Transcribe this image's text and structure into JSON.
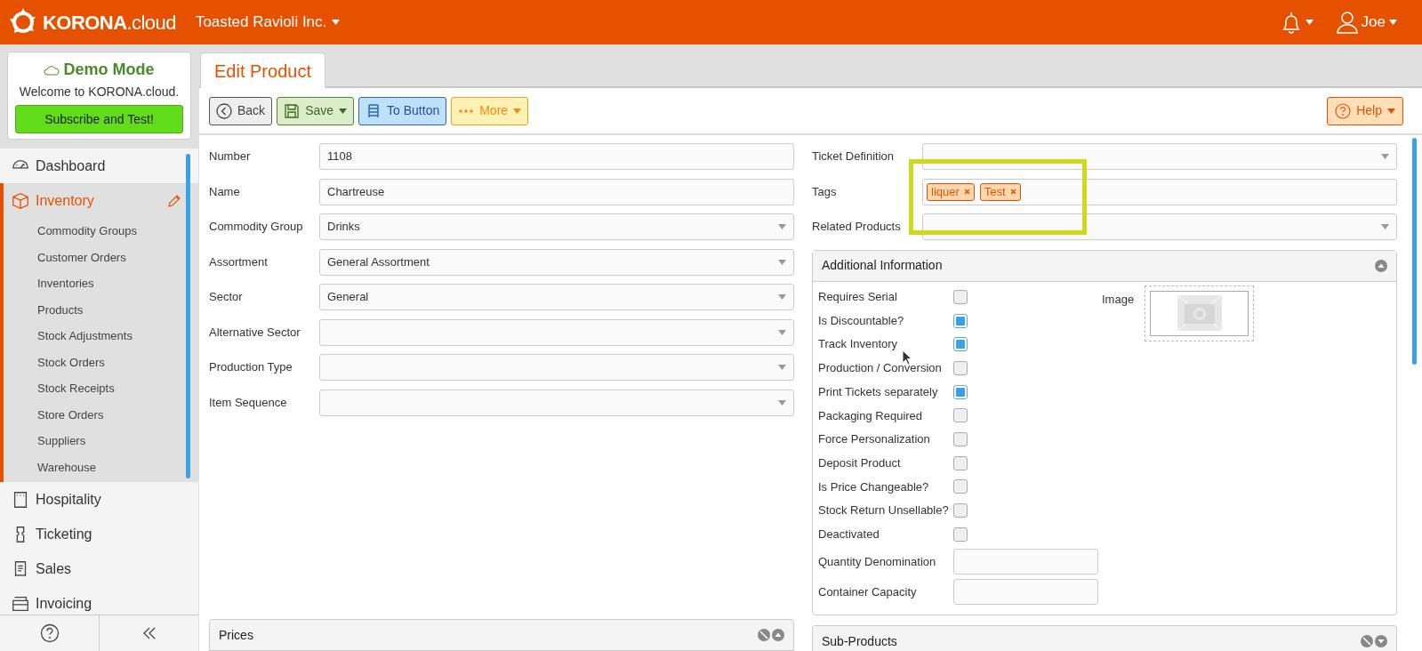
{
  "header": {
    "brand": "KORONA",
    "brand_suffix": ".cloud",
    "company": "Toasted Ravioli Inc.",
    "user": "Joe"
  },
  "demo": {
    "title": "Demo Mode",
    "welcome": "Welcome to KORONA.cloud.",
    "button": "Subscribe and Test!"
  },
  "sidebar": {
    "items": [
      {
        "label": "Dashboard",
        "selected": false
      },
      {
        "label": "Inventory",
        "selected": true,
        "expanded": true,
        "children": [
          {
            "label": "Commodity Groups",
            "selected": false
          },
          {
            "label": "Customer Orders",
            "selected": false
          },
          {
            "label": "Inventories",
            "selected": false
          },
          {
            "label": "Products",
            "selected": false
          },
          {
            "label": "Stock Adjustments",
            "selected": false
          },
          {
            "label": "Stock Orders",
            "selected": false
          },
          {
            "label": "Stock Receipts",
            "selected": false
          },
          {
            "label": "Store Orders",
            "selected": false
          },
          {
            "label": "Suppliers",
            "selected": false
          },
          {
            "label": "Warehouse",
            "selected": false
          }
        ]
      },
      {
        "label": "Hospitality",
        "selected": false
      },
      {
        "label": "Ticketing",
        "selected": false
      },
      {
        "label": "Sales",
        "selected": false
      },
      {
        "label": "Invoicing",
        "selected": false
      }
    ]
  },
  "tab": {
    "label": "Edit Product"
  },
  "toolbar": {
    "buttons": [
      {
        "kind": "back",
        "label": "Back"
      },
      {
        "kind": "save",
        "label": "Save"
      },
      {
        "kind": "to_button",
        "label": "To Button"
      },
      {
        "kind": "more",
        "label": "More"
      }
    ],
    "help": "Help"
  },
  "left_fields": [
    {
      "label": "Number",
      "kind": "text",
      "value": "1108"
    },
    {
      "label": "Name",
      "kind": "text",
      "value": "Chartreuse"
    },
    {
      "label": "Commodity Group",
      "kind": "select",
      "value": "Drinks"
    },
    {
      "label": "Assortment",
      "kind": "select",
      "value": "General Assortment"
    },
    {
      "label": "Sector",
      "kind": "select",
      "value": "General"
    },
    {
      "label": "Alternative Sector",
      "kind": "select"
    },
    {
      "label": "Production Type",
      "kind": "select"
    },
    {
      "label": "Item Sequence",
      "kind": "select"
    }
  ],
  "right_fields": [
    {
      "label": "Ticket Definition",
      "kind": "select"
    },
    {
      "label": "Tags",
      "kind": "tags",
      "tags": [
        "liquer",
        "Test"
      ]
    },
    {
      "label": "Related Products",
      "kind": "select"
    }
  ],
  "additional": {
    "title": "Additional Information",
    "image_label": "Image",
    "options": [
      {
        "label": "Requires Serial",
        "checked": false
      },
      {
        "label": "Is Discountable?",
        "checked": true
      },
      {
        "label": "Track Inventory",
        "checked": true
      },
      {
        "label": "Production / Conversion",
        "checked": false
      },
      {
        "label": "Print Tickets separately",
        "checked": true
      },
      {
        "label": "Packaging Required",
        "checked": false
      },
      {
        "label": "Force Personalization",
        "checked": false
      },
      {
        "label": "Deposit Product",
        "checked": false
      },
      {
        "label": "Is Price Changeable?",
        "checked": false
      },
      {
        "label": "Stock Return Unsellable?",
        "checked": false
      },
      {
        "label": "Deactivated",
        "checked": false
      }
    ],
    "inputs": [
      {
        "label": "Quantity Denomination"
      },
      {
        "label": "Container Capacity"
      }
    ]
  },
  "panels": [
    {
      "title": "Prices",
      "expanded": true
    },
    {
      "title": "Sub-Products",
      "expanded": false
    }
  ]
}
